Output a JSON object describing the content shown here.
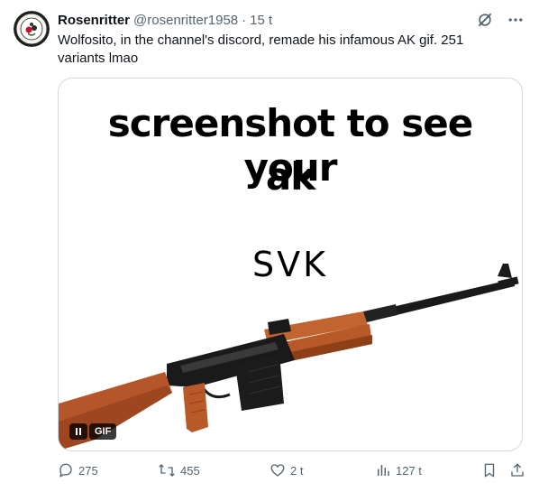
{
  "author": {
    "display_name": "Rosenritter",
    "handle": "@rosenritter1958",
    "separator": "·",
    "time": "15 t"
  },
  "tweet": {
    "text": "Wolfosito, in the channel's discord, remade his infamous AK gif. 251 variants lmao"
  },
  "media": {
    "line1": "screenshot to see your",
    "line2": "ak",
    "model": "SVK",
    "gif_badge": "GIF"
  },
  "actions": {
    "replies": "275",
    "reposts": "455",
    "likes": "2 t",
    "views": "127 t"
  },
  "colors": {
    "secondary_text": "#536471",
    "border": "#cfd9de",
    "wood": "#b5562a",
    "metal": "#1a1a1a"
  },
  "icons": [
    "grok-icon",
    "more-icon",
    "pause-icon",
    "reply-icon",
    "repost-icon",
    "like-icon",
    "views-icon",
    "bookmark-icon",
    "share-icon"
  ]
}
